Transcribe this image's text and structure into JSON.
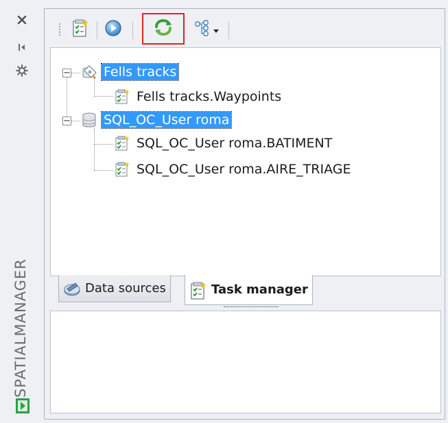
{
  "sidebar": {
    "title": "SPATIALMANAGER",
    "buttons": [
      "close-icon",
      "pin-icon",
      "settings-icon"
    ]
  },
  "toolbar": {
    "buttons": [
      {
        "name": "new-task-button",
        "icon": "document-task-icon"
      },
      {
        "name": "run-button",
        "icon": "play-icon"
      },
      {
        "name": "refresh-button",
        "icon": "refresh-icon",
        "highlighted": true
      },
      {
        "name": "tree-view-button",
        "icon": "tree-view-icon",
        "has_dropdown": true
      }
    ],
    "highlight_color": "#e22020"
  },
  "tree": {
    "nodes": [
      {
        "label": "Fells tracks",
        "selected": true,
        "icon": "gps-source-icon",
        "expanded": true,
        "children": [
          {
            "label": "Fells tracks.Waypoints",
            "icon": "task-icon"
          }
        ]
      },
      {
        "label": "SQL_OC_User roma",
        "selected": true,
        "icon": "database-icon",
        "expanded": true,
        "children": [
          {
            "label": "SQL_OC_User roma.BATIMENT",
            "icon": "task-icon"
          },
          {
            "label": "SQL_OC_User roma.AIRE_TRIAGE",
            "icon": "task-icon"
          }
        ]
      }
    ]
  },
  "tabs": [
    {
      "label": "Data sources",
      "active": false,
      "icon": "data-sources-icon"
    },
    {
      "label": "Task manager",
      "active": true,
      "icon": "task-manager-icon"
    }
  ],
  "colors": {
    "selection": "#3399ff",
    "panel_bg": "#eef0f4",
    "border": "#a9b3c2"
  }
}
